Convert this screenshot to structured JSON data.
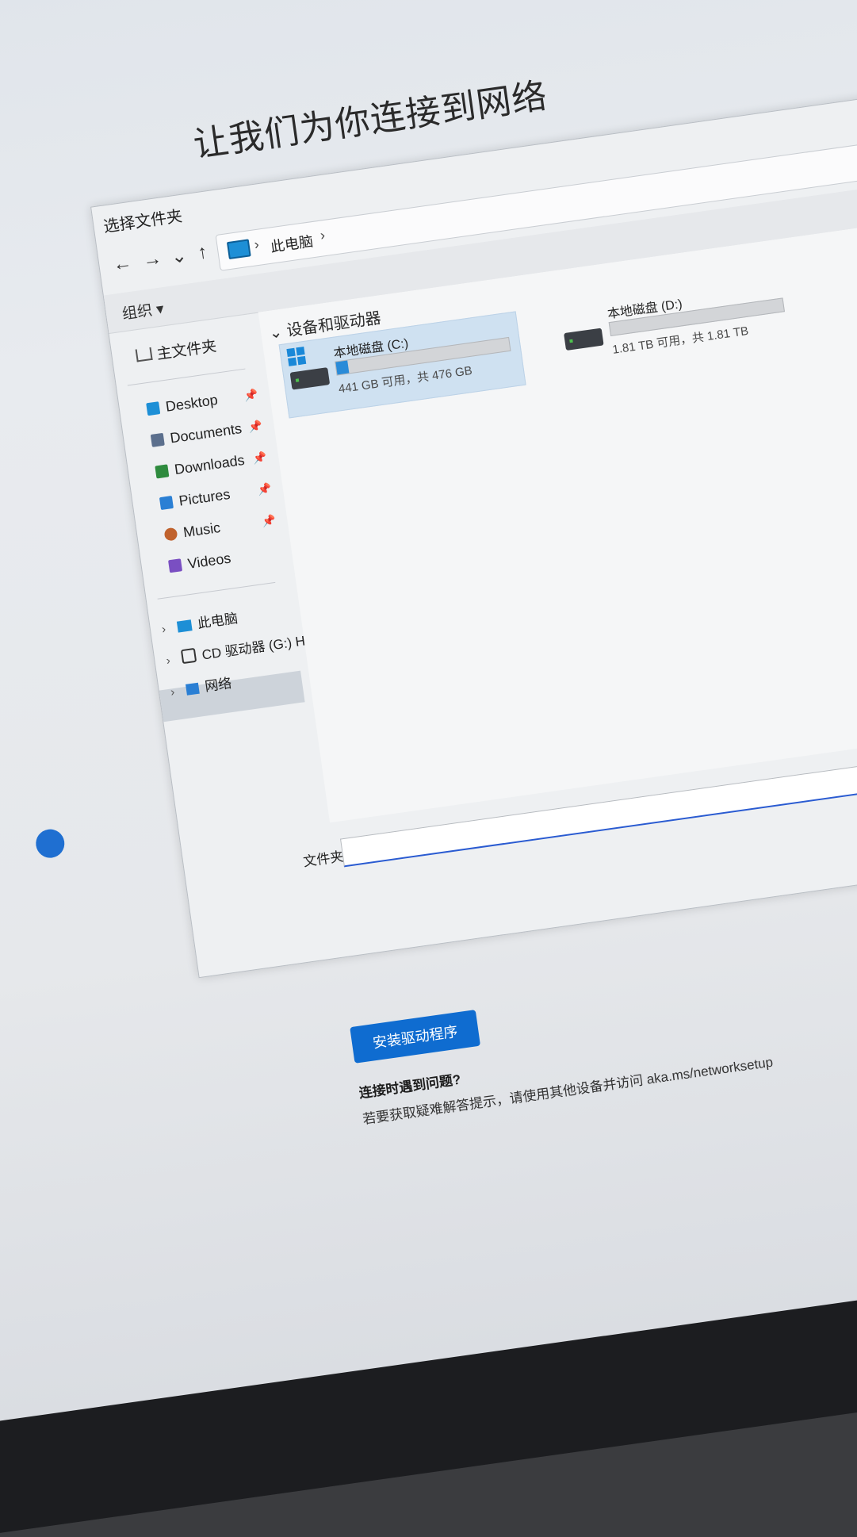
{
  "page": {
    "heading": "让我们为你连接到网络"
  },
  "dialog": {
    "title": "选择文件夹",
    "nav": {
      "back": "←",
      "forward": "→",
      "recent": "⌄",
      "up": "↑"
    },
    "address": {
      "segment": "此电脑",
      "separator": "›"
    },
    "toolbar": {
      "organize": "组织 ▾"
    },
    "sidebar": {
      "home": "主文件夹",
      "quick_access": [
        {
          "label": "Desktop",
          "icon": "desktop-icon",
          "color": "#1d8fd6"
        },
        {
          "label": "Documents",
          "icon": "documents-icon",
          "color": "#5b6f8d"
        },
        {
          "label": "Downloads",
          "icon": "downloads-icon",
          "color": "#2e8b3e"
        },
        {
          "label": "Pictures",
          "icon": "pictures-icon",
          "color": "#2a7fd4"
        },
        {
          "label": "Music",
          "icon": "music-icon",
          "color": "#c0622d"
        },
        {
          "label": "Videos",
          "icon": "videos-icon",
          "color": "#7a4fc2"
        }
      ],
      "pin_glyph": "📌",
      "tree": [
        {
          "label": "此电脑",
          "icon": "this-pc-icon",
          "selected": true
        },
        {
          "label": "CD 驱动器 (G:) HP",
          "icon": "cd-drive-icon"
        },
        {
          "label": "网络",
          "icon": "network-icon"
        }
      ],
      "chevron": "›"
    },
    "content": {
      "group": "设备和驱动器",
      "group_chevron": "⌄",
      "drives": [
        {
          "name": "本地磁盘 (C:)",
          "space": "441 GB 可用，共 476 GB",
          "used_fraction": 0.07,
          "system": true
        },
        {
          "name": "本地磁盘 (D:)",
          "space": "1.81 TB 可用，共 1.81 TB",
          "used_fraction": 0.0,
          "system": false
        }
      ]
    },
    "folder": {
      "label": "文件夹:",
      "value": ""
    }
  },
  "footer": {
    "install_button": "安装驱动程序",
    "help_title": "连接时遇到问题?",
    "help_body": "若要获取疑难解答提示，请使用其他设备并访问 aka.ms/networksetup"
  },
  "colors": {
    "accent": "#0f6cd0",
    "selection": "#cfe1f1"
  }
}
